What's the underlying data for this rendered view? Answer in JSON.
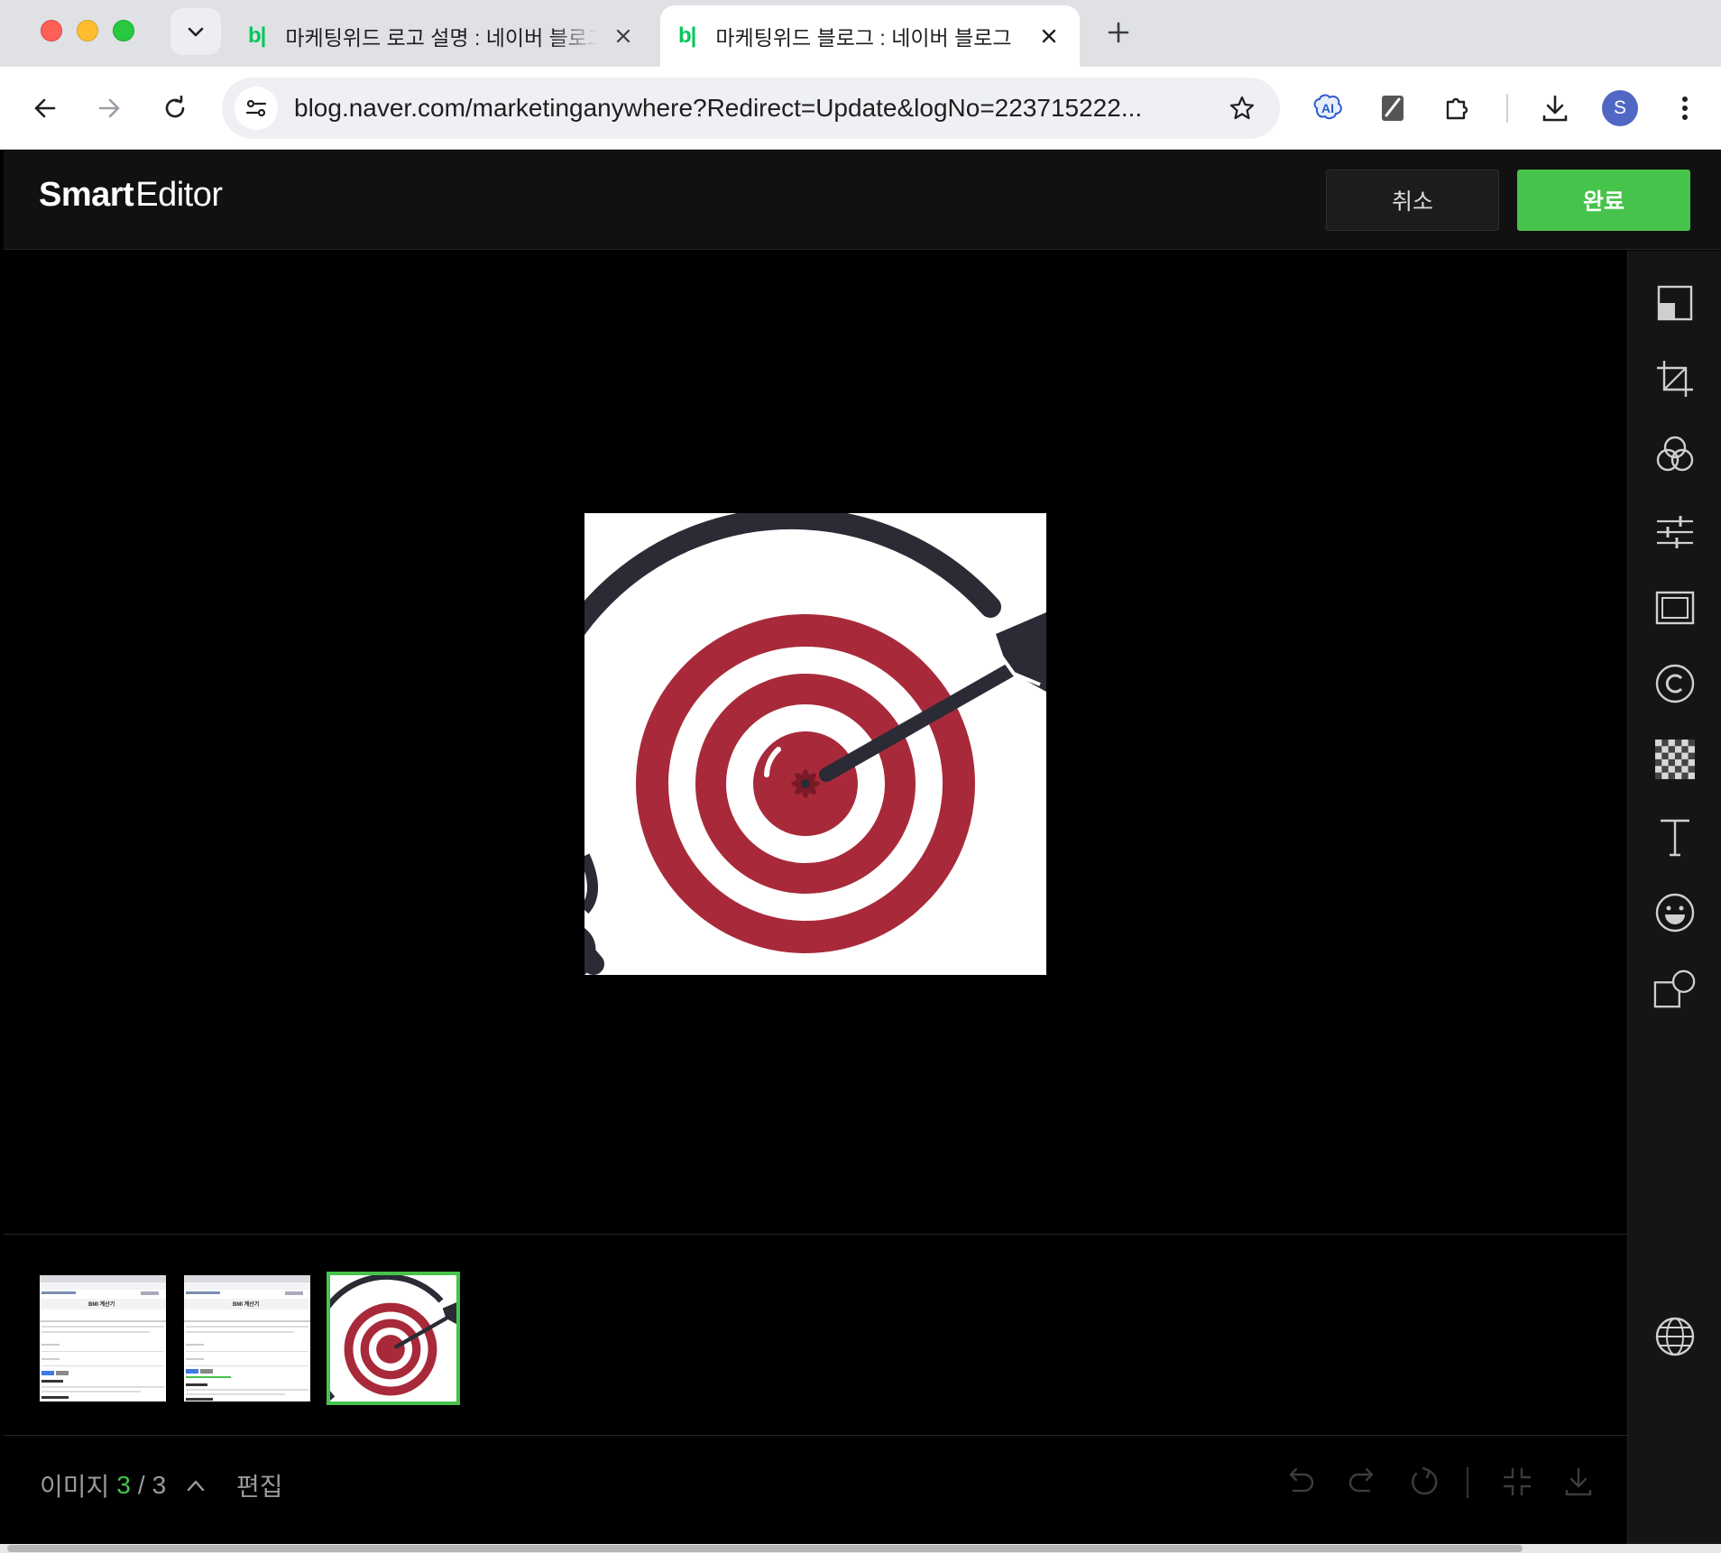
{
  "browser": {
    "tabs": [
      {
        "favicon": "b|",
        "title": "마케팅위드 로고 설명 : 네이버 블로그",
        "active": false
      },
      {
        "favicon": "b|",
        "title": "마케팅위드 블로그 : 네이버 블로그",
        "active": true
      }
    ],
    "url": "blog.naver.com/marketinganywhere?Redirect=Update&logNo=223715222...",
    "profile_initial": "S",
    "extension_ai_label": "AI"
  },
  "editor": {
    "brand_bold": "Smart",
    "brand_light": "Editor",
    "cancel_label": "취소",
    "done_label": "완료",
    "rail_icons": [
      "image-size-icon",
      "crop-icon",
      "filter-icon",
      "adjust-sliders-icon",
      "frame-icon",
      "copyright-icon",
      "mosaic-icon",
      "text-icon",
      "sticker-icon",
      "shape-icon",
      "globe-icon"
    ],
    "thumbnails": [
      {
        "kind": "screenshot",
        "heading": "BMI 계산기"
      },
      {
        "kind": "screenshot",
        "heading": "BMI 계산기"
      },
      {
        "kind": "target",
        "selected": true
      }
    ],
    "footer": {
      "image_label": "이미지",
      "current": "3",
      "separator": "/",
      "total": "3",
      "edit_label": "편집"
    },
    "colors": {
      "accent": "#46c34a",
      "target_red": "#a82a3a",
      "target_dark": "#2b2b35"
    }
  }
}
